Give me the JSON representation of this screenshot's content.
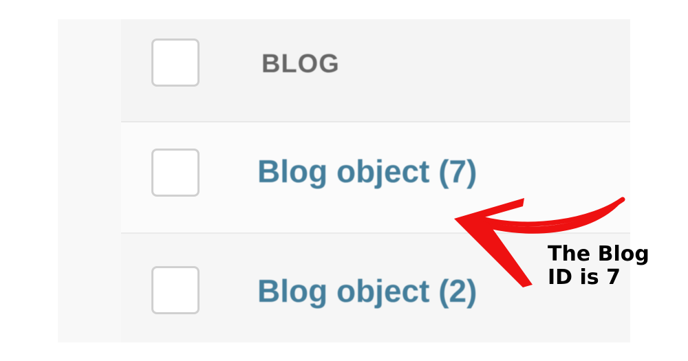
{
  "table": {
    "column_header": "BLOG",
    "rows": [
      {
        "label": "Blog object (7)"
      },
      {
        "label": "Blog object (2)"
      }
    ]
  },
  "annotation": {
    "line1": "The Blog",
    "line2": "ID is 7",
    "arrow_color": "#ee1111"
  },
  "colors": {
    "link": "#447e9b",
    "header_text": "#666666",
    "header_bg": "#f4f4f4"
  }
}
